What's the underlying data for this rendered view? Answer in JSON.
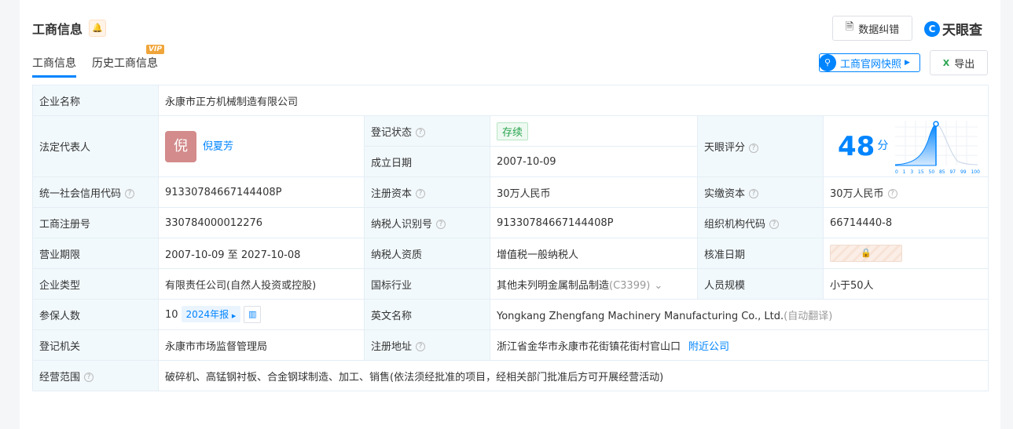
{
  "header": {
    "title": "工商信息",
    "tabs": [
      {
        "label": "工商信息"
      },
      {
        "label": "历史工商信息"
      }
    ],
    "vip": "VIP",
    "report_error": "数据纠错",
    "logo": "天眼查",
    "snapshot": "工商官网快照",
    "export": "导出"
  },
  "rows": {
    "company_name_label": "企业名称",
    "company_name": "永康市正方机械制造有限公司",
    "legal_rep_label": "法定代表人",
    "legal_rep_avatar": "倪",
    "legal_rep": "倪夏芳",
    "status_label": "登记状态",
    "status": "存续",
    "founded_label": "成立日期",
    "founded": "2007-10-09",
    "score_label": "天眼评分",
    "score": "48",
    "score_unit": "分",
    "score_axis": [
      "0",
      "1",
      "3",
      "15",
      "50",
      "85",
      "97",
      "99",
      "100"
    ],
    "credit_code_label": "统一社会信用代码",
    "credit_code": "91330784667144408P",
    "reg_capital_label": "注册资本",
    "reg_capital": "30万人民币",
    "paid_capital_label": "实缴资本",
    "paid_capital": "30万人民币",
    "reg_no_label": "工商注册号",
    "reg_no": "330784000012276",
    "taxpayer_id_label": "纳税人识别号",
    "taxpayer_id": "91330784667144408P",
    "org_code_label": "组织机构代码",
    "org_code": "66714440-8",
    "term_label": "营业期限",
    "term": "2007-10-09 至 2027-10-08",
    "taxpayer_type_label": "纳税人资质",
    "taxpayer_type": "增值税一般纳税人",
    "approve_date_label": "核准日期",
    "type_label": "企业类型",
    "type": "有限责任公司(自然人投资或控股)",
    "industry_label": "国标行业",
    "industry": "其他未列明金属制品制造",
    "industry_code": "(C3399)",
    "staff_label": "人员规模",
    "staff": "小于50人",
    "insured_label": "参保人数",
    "insured": "10",
    "insured_year": "2024年报",
    "english_label": "英文名称",
    "english": "Yongkang Zhengfang Machinery Manufacturing Co., Ltd.",
    "english_note": "(自动翻译)",
    "authority_label": "登记机关",
    "authority": "永康市市场监督管理局",
    "address_label": "注册地址",
    "address": "浙江省金华市永康市花街镇花街村官山口",
    "nearby": "附近公司",
    "scope_label": "经营范围",
    "scope": "破碎机、高锰钢衬板、合金钢球制造、加工、销售(依法须经批准的项目，经相关部门批准后方可开展经营活动)"
  }
}
